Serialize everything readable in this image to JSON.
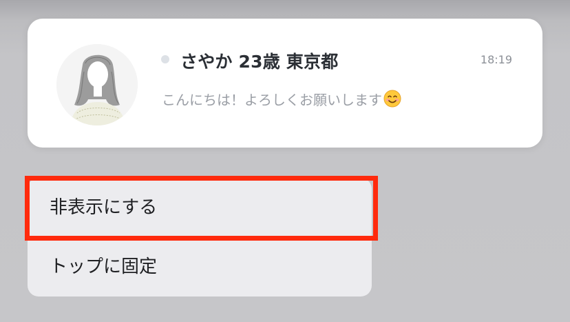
{
  "chat": {
    "name": "さやか 23歳 東京都",
    "time": "18:19",
    "message": "こんにちは！よろしくお願いします",
    "emoji": "smiling-face-emoji"
  },
  "menu": {
    "items": [
      {
        "label": "非表示にする",
        "highlighted": true
      },
      {
        "label": "トップに固定",
        "highlighted": false
      }
    ]
  },
  "colors": {
    "highlight_border": "#ff2a0d",
    "online_dot": "#dde1e6"
  }
}
